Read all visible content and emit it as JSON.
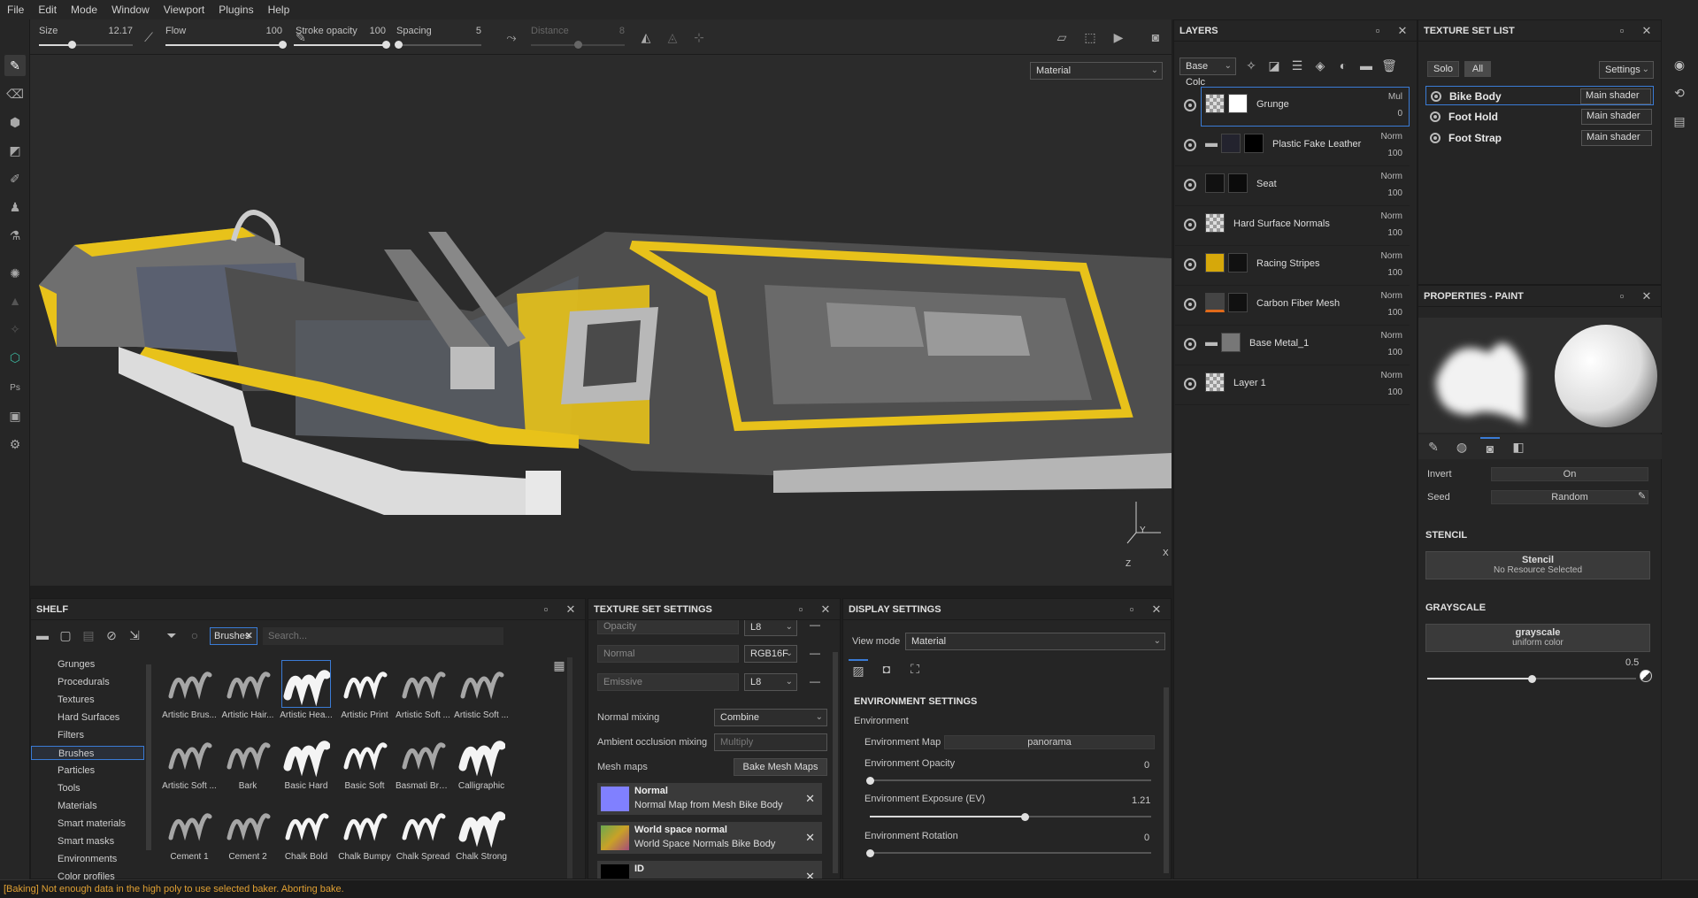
{
  "menu": [
    "File",
    "Edit",
    "Mode",
    "Window",
    "Viewport",
    "Plugins",
    "Help"
  ],
  "propbar": {
    "size": {
      "label": "Size",
      "value": "12.17",
      "fraction": 0.35
    },
    "flow": {
      "label": "Flow",
      "value": "100",
      "fraction": 1.0
    },
    "stroke_opacity": {
      "label": "Stroke opacity",
      "value": "100",
      "fraction": 1.0
    },
    "spacing": {
      "label": "Spacing",
      "value": "5",
      "fraction": 0.02
    },
    "distance": {
      "label": "Distance",
      "value": "8",
      "fraction": 0.5
    }
  },
  "viewport": {
    "mode_select": "Material",
    "gizmo": {
      "y": "Y",
      "x": "X",
      "z": "Z"
    }
  },
  "layers": {
    "title": "LAYERS",
    "channel": "Base Colc",
    "items": [
      {
        "name": "Grunge",
        "blend": "Mul",
        "opacity": "0",
        "selected": true
      },
      {
        "name": "Plastic Fake Leather",
        "blend": "Norm",
        "opacity": "100"
      },
      {
        "name": "Seat",
        "blend": "Norm",
        "opacity": "100"
      },
      {
        "name": "Hard Surface Normals",
        "blend": "Norm",
        "opacity": "100"
      },
      {
        "name": "Racing Stripes",
        "blend": "Norm",
        "opacity": "100"
      },
      {
        "name": "Carbon Fiber Mesh",
        "blend": "Norm",
        "opacity": "100"
      },
      {
        "name": "Base Metal_1",
        "blend": "Norm",
        "opacity": "100"
      },
      {
        "name": "Layer 1",
        "blend": "Norm",
        "opacity": "100"
      }
    ]
  },
  "texture_set_list": {
    "title": "TEXTURE SET LIST",
    "solo": "Solo",
    "all": "All",
    "settings": "Settings",
    "items": [
      {
        "name": "Bike Body",
        "shader": "Main shader",
        "selected": true
      },
      {
        "name": "Foot Hold",
        "shader": "Main shader"
      },
      {
        "name": "Foot Strap",
        "shader": "Main shader"
      }
    ]
  },
  "properties": {
    "title": "PROPERTIES - PAINT",
    "invert_label": "Invert",
    "invert_value": "On",
    "seed_label": "Seed",
    "seed_value": "Random",
    "stencil_section": "STENCIL",
    "stencil_title": "Stencil",
    "stencil_sub": "No Resource Selected",
    "grayscale_section": "GRAYSCALE",
    "grayscale_title": "grayscale",
    "grayscale_sub": "uniform color",
    "grayscale_value": "0.5",
    "grayscale_fraction": 0.5
  },
  "shelf": {
    "title": "SHELF",
    "filter_tag": "Brushes",
    "search_placeholder": "Search...",
    "categories": [
      "Grunges",
      "Procedurals",
      "Textures",
      "Hard Surfaces",
      "Filters",
      "Brushes",
      "Particles",
      "Tools",
      "Materials",
      "Smart materials",
      "Smart masks",
      "Environments",
      "Color profiles"
    ],
    "selected_category": "Brushes",
    "brushes": [
      "Artistic Brus...",
      "Artistic Hair...",
      "Artistic Hea...",
      "Artistic Print",
      "Artistic Soft ...",
      "Artistic Soft ...",
      "Artistic Soft ...",
      "Bark",
      "Basic Hard",
      "Basic Soft",
      "Basmati Bru...",
      "Calligraphic",
      "Cement 1",
      "Cement 2",
      "Chalk Bold",
      "Chalk Bumpy",
      "Chalk Spread",
      "Chalk Strong"
    ]
  },
  "texture_set_settings": {
    "title": "TEXTURE SET SETTINGS",
    "channels": [
      {
        "name": "Opacity",
        "format": "L8"
      },
      {
        "name": "Normal",
        "format": "RGB16F"
      },
      {
        "name": "Emissive",
        "format": "L8"
      }
    ],
    "normal_mixing_label": "Normal mixing",
    "normal_mixing_value": "Combine",
    "ao_mixing_label": "Ambient occlusion mixing",
    "ao_mixing_value": "Multiply",
    "mesh_maps_label": "Mesh maps",
    "bake_button": "Bake Mesh Maps",
    "mesh_maps": [
      {
        "title": "Normal",
        "sub": "Normal Map from Mesh Bike Body",
        "color": "#8080ff"
      },
      {
        "title": "World space normal",
        "sub": "World Space Normals Bike Body",
        "color": "#6aa84f"
      },
      {
        "title": "ID",
        "sub": "",
        "color": "#000000"
      }
    ]
  },
  "display_settings": {
    "title": "DISPLAY SETTINGS",
    "view_mode_label": "View mode",
    "view_mode_value": "Material",
    "env_section": "ENVIRONMENT SETTINGS",
    "env_label": "Environment",
    "env_map_label": "Environment Map",
    "env_map_value": "panorama",
    "env_opacity_label": "Environment Opacity",
    "env_opacity_value": "0",
    "env_opacity_fraction": 0.0,
    "env_exposure_label": "Environment Exposure (EV)",
    "env_exposure_value": "1.21",
    "env_exposure_fraction": 0.55,
    "env_rotation_label": "Environment Rotation",
    "env_rotation_value": "0",
    "env_rotation_fraction": 0.0
  },
  "status": "[Baking] Not enough data in the high poly to use selected baker. Aborting bake.",
  "colors": {
    "accent": "#3a7bd5",
    "status": "#e0a033",
    "stripe": "#e8c21a"
  }
}
